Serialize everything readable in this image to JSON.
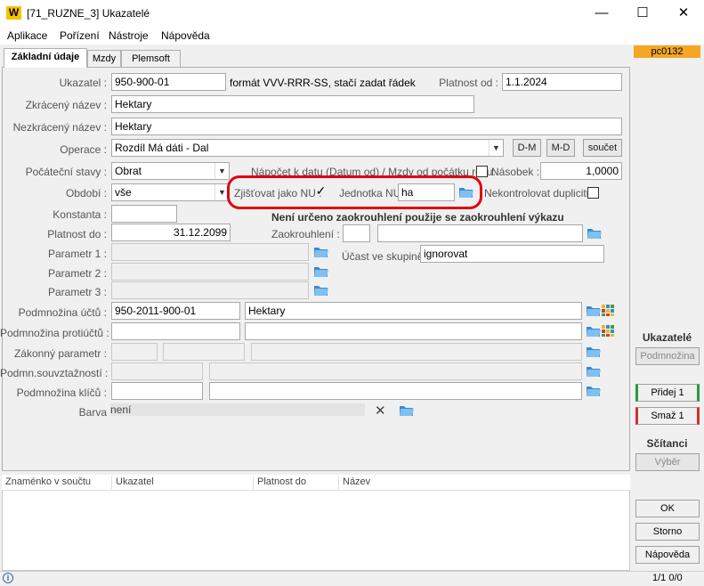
{
  "window": {
    "title": "[71_RUZNE_3] Ukazatelé",
    "logo": "W",
    "min": "—",
    "max": "☐",
    "close": "✕"
  },
  "menu": [
    "Aplikace",
    "Pořízení",
    "Nástroje",
    "Nápověda"
  ],
  "tabs": [
    "Základní údaje",
    "Mzdy",
    "Plemsoft"
  ],
  "badge": "pc0132",
  "form": {
    "ukazatel_label": "Ukazatel :",
    "ukazatel": "950-900-01",
    "format_hint": "formát VVV-RRR-SS, stačí zadat řádek",
    "platnost_od_label": "Platnost od :",
    "platnost_od": "1.1.2024",
    "zkraceny_label": "Zkrácený název :",
    "zkraceny": "Hektary",
    "nezkraceny_label": "Nezkrácený název :",
    "nezkraceny": "Hektary",
    "operace_label": "Operace :",
    "operace": "Rozdíl Má dáti - Dal",
    "btn_dm": "D-M",
    "btn_md": "M-D",
    "btn_soucet": "součet",
    "pocatecni_label": "Počáteční stavy :",
    "pocatecni": "Obrat",
    "napocet_label": "Nápočet k datu (Datum od) / Mzdy od počátku roku:",
    "nasobek_label": "Násobek :",
    "nasobek": "1,0000",
    "obdobi_label": "Období :",
    "obdobi": "vše",
    "zjistovat_label": "Zjišťovat jako NU :",
    "zjistovat_check": "✓",
    "jednotka_label": "Jednotka NU:",
    "jednotka": "ha",
    "nekontrolovat_label": "Nekontrolovat duplicitu:",
    "konstanta_label": "Konstanta :",
    "konstanta": "",
    "zaokrouhleni_info": "Není určeno zaokrouhlení použije se zaokrouhlení výkazu",
    "platnost_do_label": "Platnost do :",
    "platnost_do": "31.12.2099",
    "zaokrouhleni_label": "Zaokrouhlení :",
    "param1_label": "Parametr 1 :",
    "param2_label": "Parametr 2 :",
    "param3_label": "Parametr 3 :",
    "ucast_label": "Účast ve skupině:",
    "ucast": "ignorovat",
    "podm_uctu_label": "Podmnožina účtů :",
    "podm_uctu": "950-2011-900-01",
    "podm_uctu_name": "Hektary",
    "podm_protiuctu_label": "Podmnožina protiúčtů :",
    "zakonny_label": "Zákonný parametr :",
    "podm_souvz_label": "Podmn.souvztažností :",
    "podm_klicu_label": "Podmnožina klíčů :",
    "barva_label": "Barva",
    "barva": "není"
  },
  "grid": {
    "columns": [
      "Znaménko v součtu",
      "Ukazatel",
      "Platnost do",
      "Název"
    ]
  },
  "side": {
    "title": "Ukazatelé",
    "podmnozina": "Podmnožina",
    "pridej": "Přidej 1",
    "smaz": "Smaž 1",
    "scitanci": "Sčítanci",
    "vyber": "Výběr",
    "ok": "OK",
    "storno": "Storno",
    "napoveda": "Nápověda"
  },
  "status": {
    "info": "i",
    "pager": "1/1  0/0"
  }
}
